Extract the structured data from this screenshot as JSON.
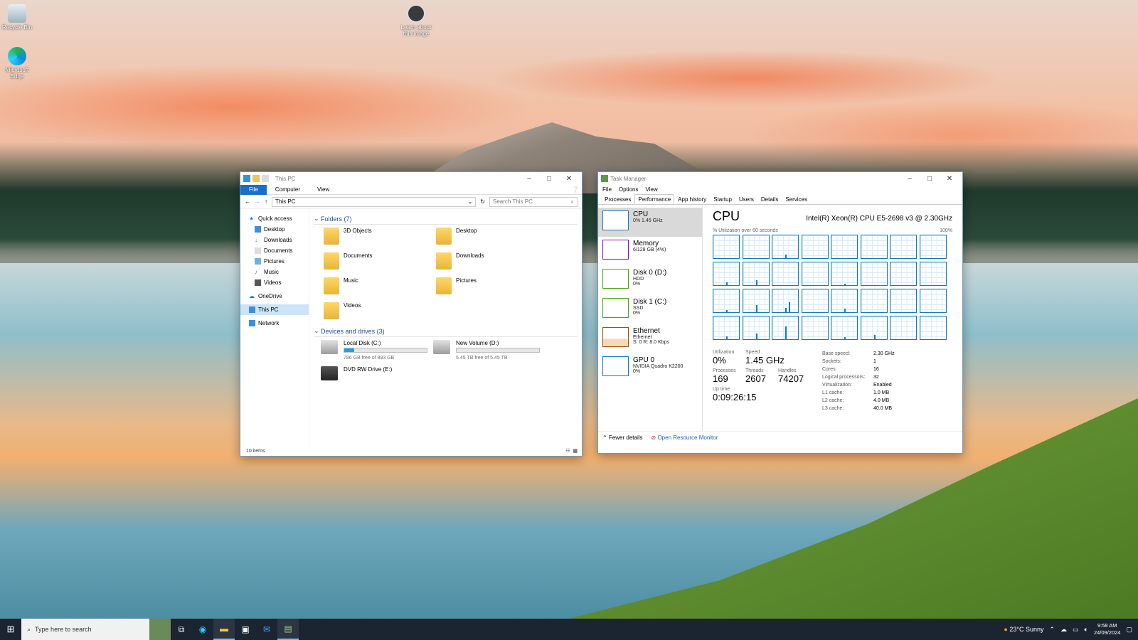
{
  "desktop": {
    "icons": [
      {
        "label": "Recycle Bin"
      },
      {
        "label": "Microsoft Edge"
      },
      {
        "label": "Learn about this image"
      }
    ]
  },
  "explorer": {
    "title": "This PC",
    "ribbon_tabs": [
      "File",
      "Computer",
      "View"
    ],
    "address": "This PC",
    "search_placeholder": "Search This PC",
    "nav": [
      {
        "label": "Quick access"
      },
      {
        "label": "Desktop"
      },
      {
        "label": "Downloads"
      },
      {
        "label": "Documents"
      },
      {
        "label": "Pictures"
      },
      {
        "label": "Music"
      },
      {
        "label": "Videos"
      },
      {
        "label": "OneDrive"
      },
      {
        "label": "This PC"
      },
      {
        "label": "Network"
      }
    ],
    "folders_header": "Folders (7)",
    "folders": [
      "3D Objects",
      "Desktop",
      "Documents",
      "Downloads",
      "Music",
      "Pictures",
      "Videos"
    ],
    "drives_header": "Devices and drives (3)",
    "drives": [
      {
        "name": "Local Disk (C:)",
        "free": "786 GB free of 893 GB",
        "used_fraction": 0.12
      },
      {
        "name": "New Volume (D:)",
        "free": "5.45 TB free of 5.45 TB",
        "used_fraction": 0.0
      },
      {
        "name": "DVD RW Drive (E:)",
        "free": ""
      }
    ],
    "status": "10 items"
  },
  "taskmanager": {
    "title": "Task Manager",
    "menu": [
      "File",
      "Options",
      "View"
    ],
    "tabs": [
      "Processes",
      "Performance",
      "App history",
      "Startup",
      "Users",
      "Details",
      "Services"
    ],
    "side": [
      {
        "name": "CPU",
        "sub1": "0% 1.45 GHz",
        "sub2": "",
        "color": "#117dbb"
      },
      {
        "name": "Memory",
        "sub1": "6/128 GB (4%)",
        "sub2": "",
        "color": "#8b12ae"
      },
      {
        "name": "Disk 0 (D:)",
        "sub1": "HDD",
        "sub2": "0%",
        "color": "#4da60c"
      },
      {
        "name": "Disk 1 (C:)",
        "sub1": "SSD",
        "sub2": "0%",
        "color": "#4da60c"
      },
      {
        "name": "Ethernet",
        "sub1": "Ethernet",
        "sub2": "S: 0 R: 8.0 Kbps",
        "color": "#a74f01"
      },
      {
        "name": "GPU 0",
        "sub1": "NVIDIA Quadro K2200",
        "sub2": "0%",
        "color": "#117dbb"
      }
    ],
    "perf_title": "CPU",
    "model": "Intel(R) Xeon(R) CPU E5-2698 v3 @ 2.30GHz",
    "util_label": "% Utilization over 60 seconds",
    "util_max": "100%",
    "stats": {
      "utilization_label": "Utilization",
      "utilization": "0%",
      "speed_label": "Speed",
      "speed": "1.45 GHz",
      "processes_label": "Processes",
      "processes": "169",
      "threads_label": "Threads",
      "threads": "2607",
      "handles_label": "Handles",
      "handles": "74207",
      "uptime_label": "Up time",
      "uptime": "0:09:26:15"
    },
    "specs": [
      [
        "Base speed:",
        "2.30 GHz"
      ],
      [
        "Sockets:",
        "1"
      ],
      [
        "Cores:",
        "16"
      ],
      [
        "Logical processors:",
        "32"
      ],
      [
        "Virtualization:",
        "Enabled"
      ],
      [
        "L1 cache:",
        "1.0 MB"
      ],
      [
        "L2 cache:",
        "4.0 MB"
      ],
      [
        "L3 cache:",
        "40.0 MB"
      ]
    ],
    "fewer_details": "Fewer details",
    "resource_monitor": "Open Resource Monitor"
  },
  "taskbar": {
    "search_placeholder": "Type here to search",
    "weather": "23°C  Sunny",
    "time": "9:58 AM",
    "date": "24/09/2024"
  }
}
